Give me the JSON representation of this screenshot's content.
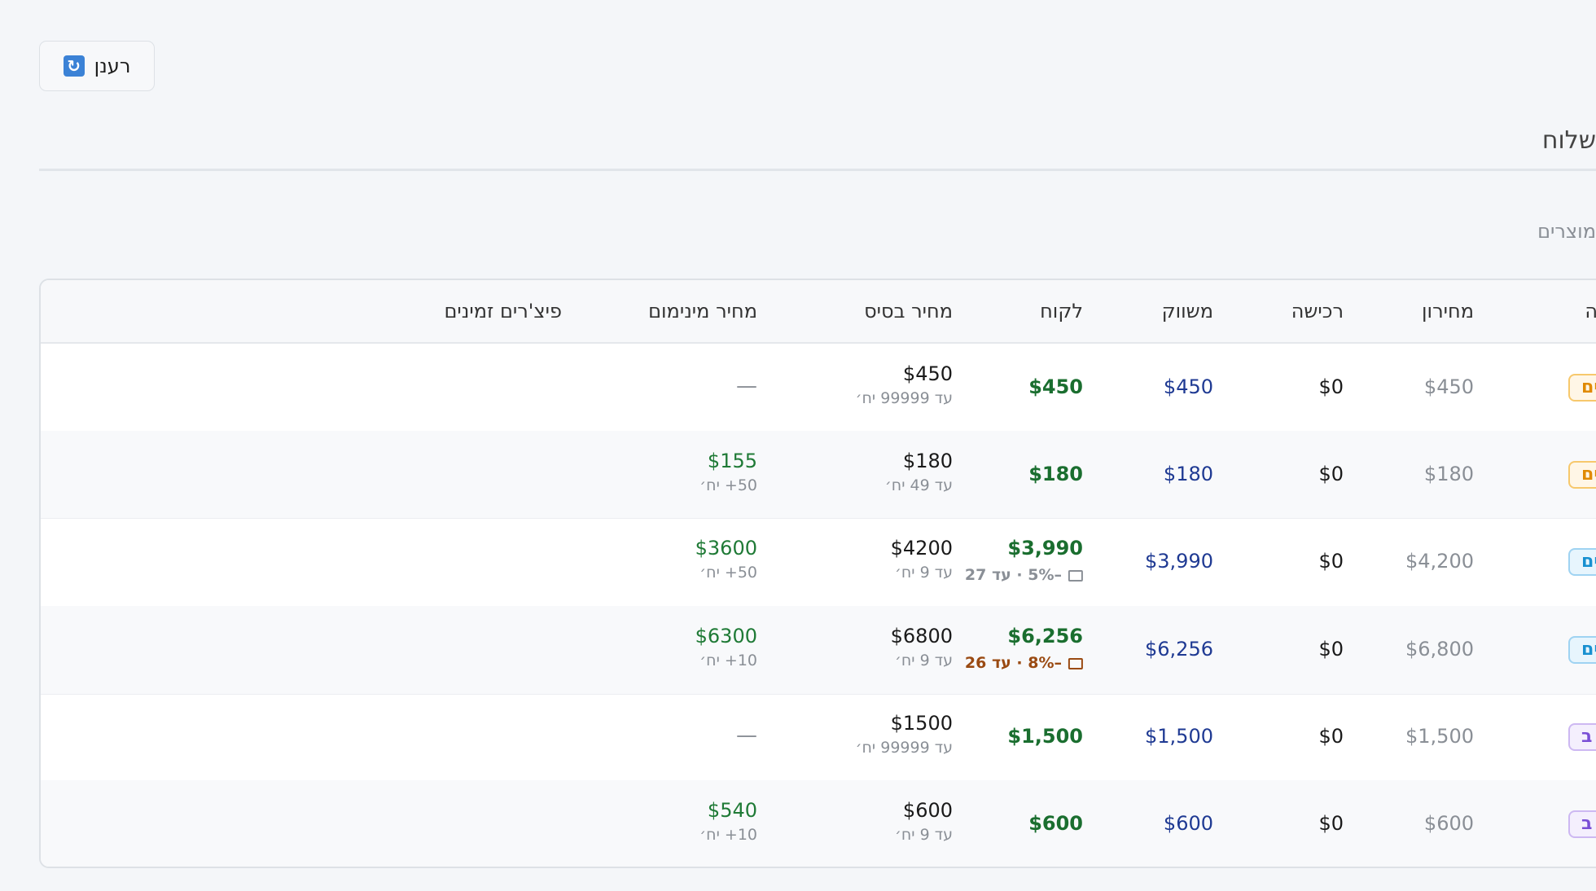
{
  "toolbar": {
    "refresh_label": "רענן",
    "refresh_icon": "🔄"
  },
  "section_title": "שלוח",
  "sub_title": "מוצרים",
  "colors": {
    "green": "#1a6e2f",
    "blue": "#1f3a93",
    "muted": "#8a8f96",
    "warn": "#9a4a12"
  },
  "columns": {
    "partial": "ה",
    "list": "מחירון",
    "purchase": "רכישה",
    "market": "משווק",
    "customer": "לקוח",
    "base": "מחיר בסיס",
    "min": "מחיר מינימום",
    "features": "פיצ'רים זמינים"
  },
  "rows": [
    {
      "badge": "ים",
      "badge_color": "orange",
      "list": "$450",
      "purchase": "$0",
      "market": "$450",
      "customer": "$450",
      "promo": "",
      "base": "$450",
      "base_sub": "עד 99999 יח׳",
      "min": "—",
      "min_sub": ""
    },
    {
      "badge": "ים",
      "badge_color": "orange",
      "list": "$180",
      "purchase": "$0",
      "market": "$180",
      "customer": "$180",
      "promo": "",
      "base": "$180",
      "base_sub": "עד 49 יח׳",
      "min": "$155",
      "min_sub": "50+ יח׳"
    },
    {
      "badge": "ים",
      "badge_color": "blue",
      "list": "$4,200",
      "purchase": "$0",
      "market": "$3,990",
      "customer": "$3,990",
      "promo": "–5% · עד 27",
      "promo_style": "muted",
      "base": "$4200",
      "base_sub": "עד 9 יח׳",
      "min": "$3600",
      "min_sub": "50+ יח׳"
    },
    {
      "badge": "ים",
      "badge_color": "blue",
      "list": "$6,800",
      "purchase": "$0",
      "market": "$6,256",
      "customer": "$6,256",
      "promo": "–8% · עד 26",
      "promo_style": "warn",
      "base": "$6800",
      "base_sub": "עד 9 יח׳",
      "min": "$6300",
      "min_sub": "10+ יח׳"
    },
    {
      "badge": "ב",
      "badge_color": "purple",
      "list": "$1,500",
      "purchase": "$0",
      "market": "$1,500",
      "customer": "$1,500",
      "promo": "",
      "base": "$1500",
      "base_sub": "עד 99999 יח׳",
      "min": "—",
      "min_sub": ""
    },
    {
      "badge": "ב",
      "badge_color": "purple",
      "list": "$600",
      "purchase": "$0",
      "market": "$600",
      "customer": "$600",
      "promo": "",
      "base": "$600",
      "base_sub": "עד 9 יח׳",
      "min": "$540",
      "min_sub": "10+ יח׳"
    }
  ]
}
